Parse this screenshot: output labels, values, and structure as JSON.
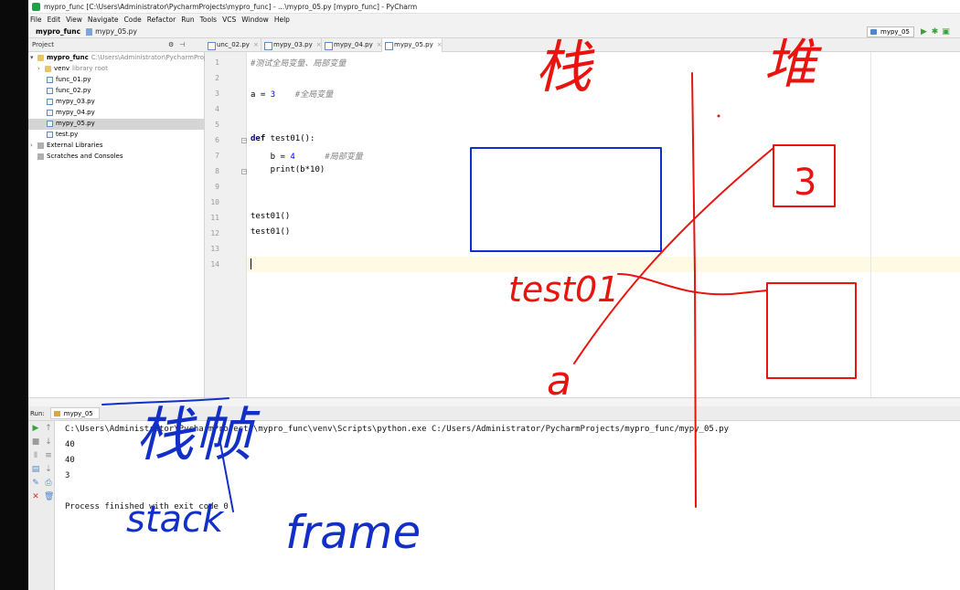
{
  "window": {
    "title": "mypro_func [C:\\Users\\Administrator\\PycharmProjects\\mypro_func] - ...\\mypro_05.py [mypro_func] - PyCharm"
  },
  "menu": [
    "File",
    "Edit",
    "View",
    "Navigate",
    "Code",
    "Refactor",
    "Run",
    "Tools",
    "VCS",
    "Window",
    "Help"
  ],
  "navbar": {
    "project": "mypro_func",
    "file": "mypy_05.py"
  },
  "run_config": {
    "selected": "mypy_05"
  },
  "project_panel": {
    "header": "Project",
    "root": {
      "name": "mypro_func",
      "path": "C:\\Users\\Administrator\\PycharmProject"
    },
    "venv": {
      "name": "venv",
      "hint": "library root"
    },
    "files": [
      "func_01.py",
      "func_02.py",
      "mypy_03.py",
      "mypy_04.py",
      "mypy_05.py",
      "test.py"
    ],
    "selected_file": "mypy_05.py",
    "external_libraries": "External Libraries",
    "scratches": "Scratches and Consoles"
  },
  "tabs": [
    {
      "label": "unc_02.py",
      "active": false
    },
    {
      "label": "mypy_03.py",
      "active": false
    },
    {
      "label": "mypy_04.py",
      "active": false
    },
    {
      "label": "mypy_05.py",
      "active": true
    }
  ],
  "editor": {
    "line_numbers": [
      "1",
      "2",
      "3",
      "4",
      "5",
      "6",
      "7",
      "8",
      "9",
      "10",
      "11",
      "12",
      "13",
      "14"
    ],
    "lines": {
      "l1_comment": "#测试全局变量、局部变量",
      "l3_code": "a = ",
      "l3_num": "3",
      "l3_comment": "#全局变量",
      "l6_kw": "def",
      "l6_code": " test01():",
      "l7_code": "    b = ",
      "l7_num": "4",
      "l7_comment": "#局部变量",
      "l8_code": "    print(b*10)",
      "l11_code": "test01()",
      "l12_code": "test01()"
    }
  },
  "run_panel": {
    "label": "Run:",
    "tab": "mypy_05",
    "console": [
      "C:\\Users\\Administrator\\PycharmProjects\\mypro_func\\venv\\Scripts\\python.exe C:/Users/Administrator/PycharmProjects/mypro_func/mypy_05.py",
      "40",
      "40",
      "3",
      "",
      "Process finished with exit code 0"
    ]
  },
  "annotations": {
    "red_stack_label": "栈",
    "red_heap_label": "堆",
    "red_func_label": "test01",
    "red_var_label": "a",
    "red_box_value": "3",
    "blue_label_cn": "栈帧",
    "blue_label_en1": "stack",
    "blue_label_en2": "frame"
  },
  "colors": {
    "red_ink": "#e8140f",
    "blue_ink": "#1230c8",
    "selection": "#d5d5d5",
    "keyword": "#000080",
    "number": "#0000ff",
    "comment": "#808080"
  }
}
